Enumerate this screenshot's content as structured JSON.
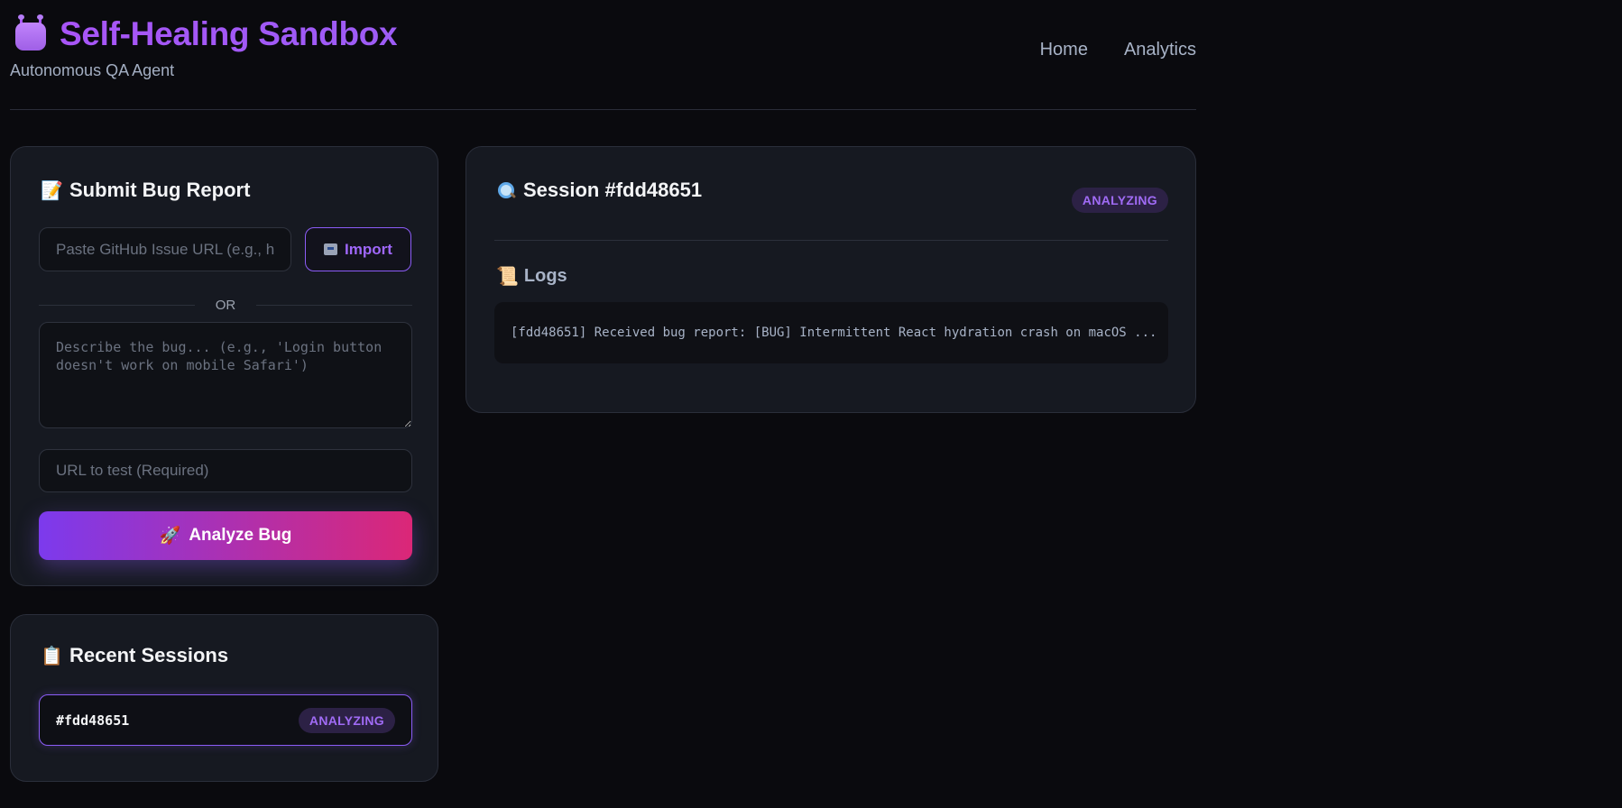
{
  "header": {
    "title": "Self-Healing Sandbox",
    "subtitle": "Autonomous QA Agent",
    "nav": [
      "Home",
      "Analytics"
    ]
  },
  "submit": {
    "title": "Submit Bug Report",
    "title_icon": "📝",
    "github_placeholder": "Paste GitHub Issue URL (e.g., h",
    "import_label": "Import",
    "or_label": "OR",
    "description_placeholder": "Describe the bug... (e.g., 'Login button doesn't work on mobile Safari')",
    "url_placeholder": "URL to test (Required)",
    "analyze_label": "Analyze Bug",
    "analyze_icon": "🚀"
  },
  "recent": {
    "title": "Recent Sessions",
    "title_icon": "📋",
    "sessions": [
      {
        "id": "#fdd48651",
        "status": "ANALYZING"
      }
    ]
  },
  "session": {
    "title": "Session #fdd48651",
    "status": "ANALYZING",
    "logs_title": "Logs",
    "logs_icon": "📜",
    "log_line": "[fdd48651] Received bug report: [BUG] Intermittent React hydration crash on macOS ..."
  },
  "colors": {
    "accent": "#8b5cf6",
    "gradient_start": "#7c3aed",
    "gradient_end": "#db2777",
    "background": "#0a0a0e",
    "card": "#161921"
  }
}
